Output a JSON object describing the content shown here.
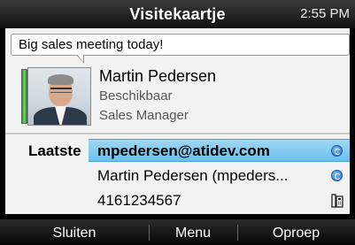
{
  "header": {
    "title": "Visitekaartje",
    "time": "2:55 PM"
  },
  "contact": {
    "status_message": "Big sales meeting today!",
    "name": "Martin Pedersen",
    "availability": "Beschikbaar",
    "job_title": "Sales Manager",
    "presence_color": "#3cc43c",
    "avatar_icon": "contact-photo"
  },
  "details": {
    "label": "Laatste",
    "rows": [
      {
        "value": "mpedersen@atidev.com",
        "icon": "presence-icon",
        "selected": true
      },
      {
        "value": "Martin Pedersen (mpeders...",
        "icon": "presence-icon",
        "selected": false
      },
      {
        "value": "4161234567",
        "icon": "phone-icon",
        "selected": false
      }
    ],
    "selection_color": "#8fd0f2"
  },
  "softkeys": {
    "left": "Sluiten",
    "middle": "Menu",
    "right": "Oproep"
  }
}
